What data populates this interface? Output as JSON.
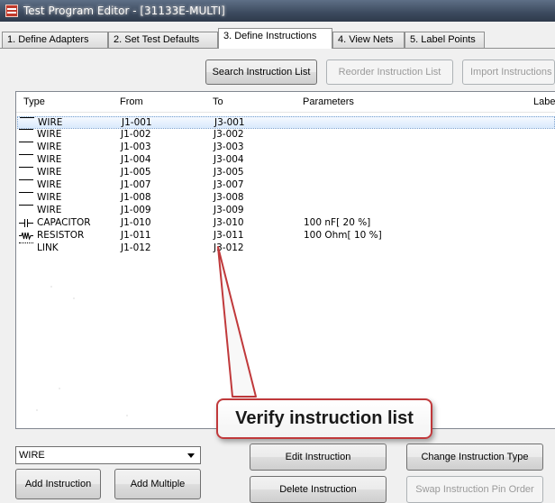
{
  "window": {
    "title": "Test Program Editor - [31133E-MULTI]"
  },
  "tabs": [
    {
      "label": "1. Define Adapters"
    },
    {
      "label": "2. Set Test Defaults"
    },
    {
      "label": "3. Define Instructions",
      "active": true
    },
    {
      "label": "4. View Nets"
    },
    {
      "label": "5. Label Points"
    }
  ],
  "toolbar": {
    "search_label": "Search Instruction List",
    "reorder_label": "Reorder Instruction List",
    "import_label": "Import Instructions"
  },
  "list": {
    "columns": [
      "Type",
      "From",
      "To",
      "Parameters",
      "Label"
    ],
    "rows": [
      {
        "icon": "wire-icon",
        "type": "WIRE",
        "from": "J1-001",
        "to": "J3-001",
        "params": "",
        "selected": true
      },
      {
        "icon": "wire-icon",
        "type": "WIRE",
        "from": "J1-002",
        "to": "J3-002",
        "params": ""
      },
      {
        "icon": "wire-icon",
        "type": "WIRE",
        "from": "J1-003",
        "to": "J3-003",
        "params": ""
      },
      {
        "icon": "wire-icon",
        "type": "WIRE",
        "from": "J1-004",
        "to": "J3-004",
        "params": ""
      },
      {
        "icon": "wire-icon",
        "type": "WIRE",
        "from": "J1-005",
        "to": "J3-005",
        "params": ""
      },
      {
        "icon": "wire-icon",
        "type": "WIRE",
        "from": "J1-007",
        "to": "J3-007",
        "params": ""
      },
      {
        "icon": "wire-icon",
        "type": "WIRE",
        "from": "J1-008",
        "to": "J3-008",
        "params": ""
      },
      {
        "icon": "wire-icon",
        "type": "WIRE",
        "from": "J1-009",
        "to": "J3-009",
        "params": ""
      },
      {
        "icon": "capacitor-icon",
        "type": "CAPACITOR",
        "from": "J1-010",
        "to": "J3-010",
        "params": "100 nF[ 20 %]"
      },
      {
        "icon": "resistor-icon",
        "type": "RESISTOR",
        "from": "J1-011",
        "to": "J3-011",
        "params": "100 Ohm[ 10 %]"
      },
      {
        "icon": "link-icon",
        "type": "LINK",
        "from": "J1-012",
        "to": "J3-012",
        "params": ""
      }
    ]
  },
  "callout": {
    "text": "Verify instruction list",
    "border_color": "#c0393b"
  },
  "bottom": {
    "type_select_value": "WIRE",
    "add_instruction_label": "Add Instruction",
    "add_multiple_label": "Add Multiple",
    "edit_instruction_label": "Edit Instruction",
    "delete_instruction_label": "Delete Instruction",
    "change_type_label": "Change Instruction Type",
    "swap_pin_order_label": "Swap Instruction Pin Order"
  },
  "colors": {
    "titlebar": "#3c4a5e",
    "selection": "#d9e9fc",
    "callout_border": "#c0393b"
  }
}
